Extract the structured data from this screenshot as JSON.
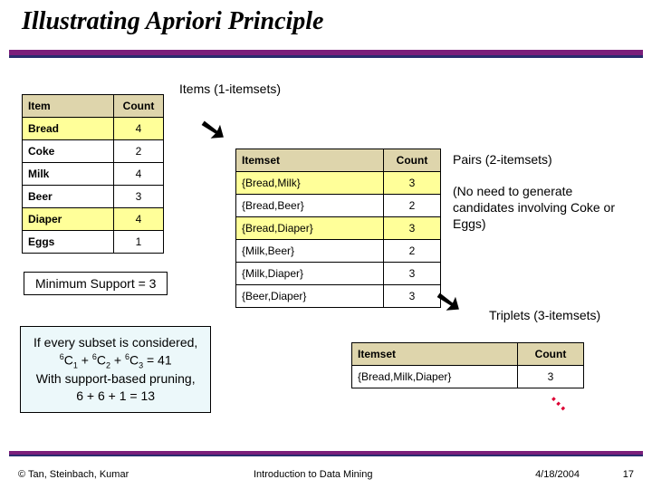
{
  "title": "Illustrating Apriori Principle",
  "labels": {
    "items": "Items (1-itemsets)",
    "pairs": "Pairs (2-itemsets)",
    "triplets": "Triplets (3-itemsets)",
    "pairs_note": "(No need to generate candidates involving Coke or Eggs)",
    "minsup": "Minimum Support = 3"
  },
  "table1": {
    "head": [
      "Item",
      "Count"
    ],
    "rows": [
      [
        "Bread",
        "4"
      ],
      [
        "Coke",
        "2"
      ],
      [
        "Milk",
        "4"
      ],
      [
        "Beer",
        "3"
      ],
      [
        "Diaper",
        "4"
      ],
      [
        "Eggs",
        "1"
      ]
    ]
  },
  "table2": {
    "head": [
      "Itemset",
      "Count"
    ],
    "rows": [
      [
        "{Bread,Milk}",
        "3"
      ],
      [
        "{Bread,Beer}",
        "2"
      ],
      [
        "{Bread,Diaper}",
        "3"
      ],
      [
        "{Milk,Beer}",
        "2"
      ],
      [
        "{Milk,Diaper}",
        "3"
      ],
      [
        "{Beer,Diaper}",
        "3"
      ]
    ]
  },
  "table3": {
    "head": [
      "Itemset",
      "Count"
    ],
    "rows": [
      [
        "{Bread,Milk,Diaper}",
        "3"
      ]
    ]
  },
  "calc": {
    "l1": "If every subset is considered,",
    "l3": "With support-based pruning,",
    "l4": "6 + 6 + 1 = 13"
  },
  "footer": {
    "copyright": "© Tan, Steinbach, Kumar",
    "center": "Introduction to Data Mining",
    "date": "4/18/2004",
    "page": "17"
  }
}
